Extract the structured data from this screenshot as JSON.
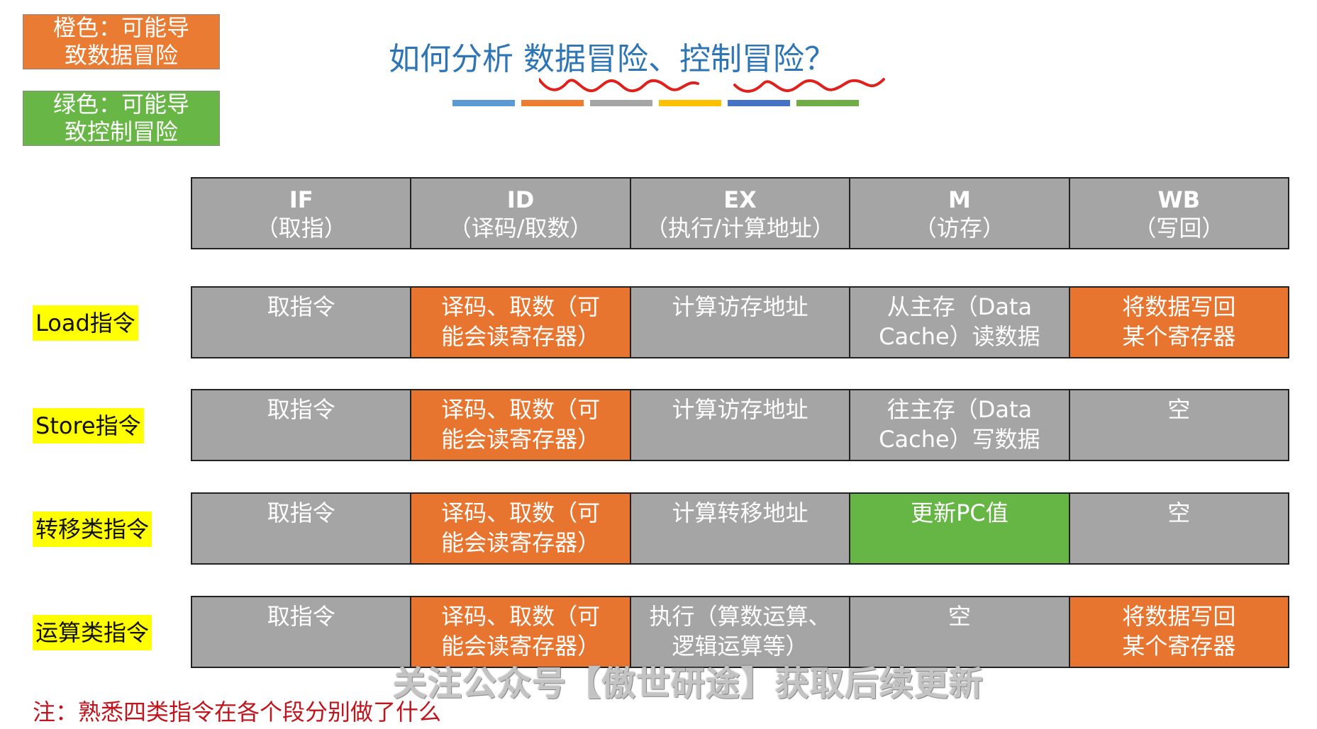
{
  "legend": {
    "orange": {
      "line1": "橙色：可能导",
      "line2": "致数据冒险"
    },
    "green": {
      "line1": "绿色：可能导",
      "line2": "致控制冒险"
    }
  },
  "title": {
    "prefix": "如何分析 ",
    "data_hazard": "数据冒险",
    "sep": "、",
    "control_hazard": "控制冒险",
    "suffix": "？"
  },
  "color_bars": [
    "#5b9bd5",
    "#ed7d31",
    "#a5a5a5",
    "#ffc000",
    "#4472c4",
    "#70ad47"
  ],
  "header": [
    {
      "stage": "IF",
      "desc": "（取指）"
    },
    {
      "stage": "ID",
      "desc": "（译码/取数）"
    },
    {
      "stage": "EX",
      "desc": "（执行/计算地址）"
    },
    {
      "stage": "M",
      "desc": "（访存）"
    },
    {
      "stage": "WB",
      "desc": "（写回）"
    }
  ],
  "rows": [
    {
      "label": "Load指令",
      "cells": [
        {
          "lines": [
            "取指令"
          ],
          "color": "gray"
        },
        {
          "lines": [
            "译码、取数（可",
            "能会读寄存器）"
          ],
          "color": "orange"
        },
        {
          "lines": [
            "计算访存地址"
          ],
          "color": "gray"
        },
        {
          "lines": [
            "从主存（Data",
            "Cache）读数据"
          ],
          "color": "gray"
        },
        {
          "lines": [
            "将数据写回",
            "某个寄存器"
          ],
          "color": "orange"
        }
      ]
    },
    {
      "label": "Store指令",
      "cells": [
        {
          "lines": [
            "取指令"
          ],
          "color": "gray"
        },
        {
          "lines": [
            "译码、取数（可",
            "能会读寄存器）"
          ],
          "color": "orange"
        },
        {
          "lines": [
            "计算访存地址"
          ],
          "color": "gray"
        },
        {
          "lines": [
            "往主存（Data",
            "Cache）写数据"
          ],
          "color": "gray"
        },
        {
          "lines": [
            "空"
          ],
          "color": "gray"
        }
      ]
    },
    {
      "label": "转移类指令",
      "cells": [
        {
          "lines": [
            "取指令"
          ],
          "color": "gray"
        },
        {
          "lines": [
            "译码、取数（可",
            "能会读寄存器）"
          ],
          "color": "orange"
        },
        {
          "lines": [
            "计算转移地址"
          ],
          "color": "gray"
        },
        {
          "lines": [
            "更新PC值"
          ],
          "color": "green"
        },
        {
          "lines": [
            "空"
          ],
          "color": "gray"
        }
      ]
    },
    {
      "label": "运算类指令",
      "cells": [
        {
          "lines": [
            "取指令"
          ],
          "color": "gray"
        },
        {
          "lines": [
            "译码、取数（可",
            "能会读寄存器）"
          ],
          "color": "orange"
        },
        {
          "lines": [
            "执行（算数运算、",
            "逻辑运算等）"
          ],
          "color": "gray"
        },
        {
          "lines": [
            "空"
          ],
          "color": "gray"
        },
        {
          "lines": [
            "将数据写回",
            "某个寄存器"
          ],
          "color": "orange"
        }
      ]
    }
  ],
  "note": "注：熟悉四类指令在各个段分别做了什么",
  "watermark": "关注公众号【傲世研途】获取后续更新"
}
